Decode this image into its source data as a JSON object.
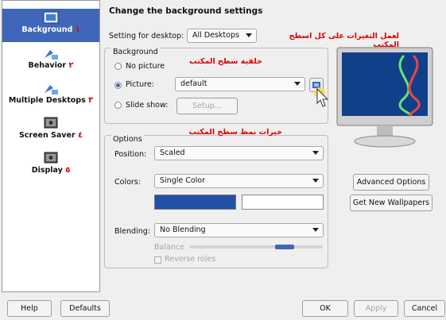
{
  "window": {
    "title": "Change the background settings"
  },
  "sidebar": {
    "items": [
      {
        "label": "Background",
        "mark": "١"
      },
      {
        "label": "Behavior",
        "mark": "٢"
      },
      {
        "label": "Multiple Desktops",
        "mark": "٣"
      },
      {
        "label": "Screen Saver",
        "mark": "٤"
      },
      {
        "label": "Display",
        "mark": "٥"
      }
    ]
  },
  "desktop_setting": {
    "label": "Setting for desktop:",
    "value": "All Desktops",
    "note_ar": "لعمل التغيرات على كل اسطح المكتب"
  },
  "background": {
    "group_label": "Background",
    "note_ar": "خلفية سطح المكتب",
    "no_picture": "No picture",
    "picture": "Picture:",
    "picture_value": "default",
    "slide_show": "Slide show:",
    "setup": "Setup..."
  },
  "options": {
    "group_label": "Options",
    "note_ar": "خيرات نمط سطح المكتب",
    "position_label": "Position:",
    "position_value": "Scaled",
    "colors_label": "Colors:",
    "colors_value": "Single Color",
    "color1": "#2250a6",
    "color2": "#ffffff",
    "blending_label": "Blending:",
    "blending_value": "No Blending",
    "balance": "Balance",
    "reverse_roles": "Reverse roles"
  },
  "right": {
    "advanced_options": "Advanced Options",
    "get_new_wallpapers": "Get New Wallpapers"
  },
  "footer": {
    "help": "Help",
    "defaults": "Defaults",
    "ok": "OK",
    "apply": "Apply",
    "cancel": "Cancel"
  }
}
